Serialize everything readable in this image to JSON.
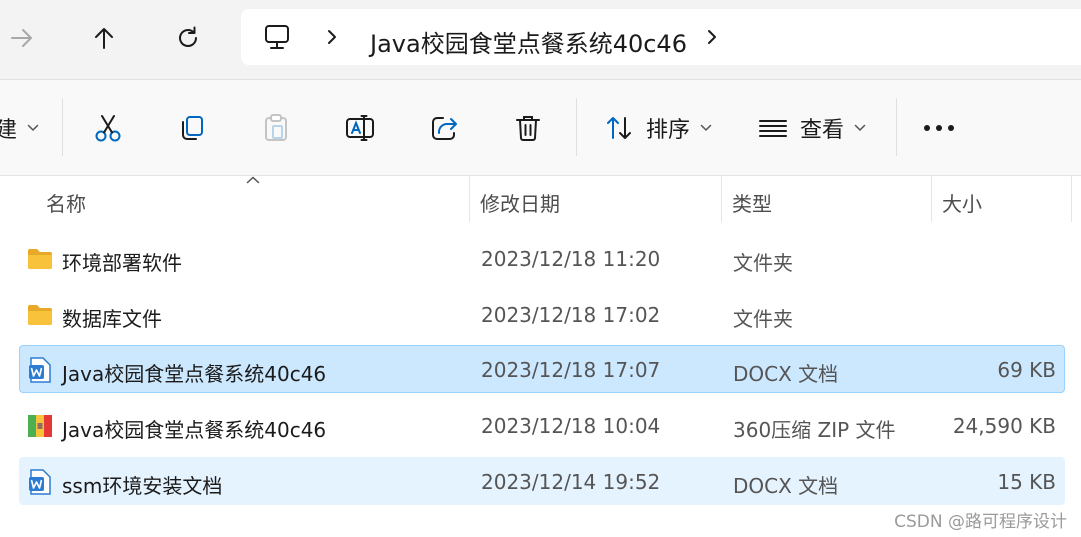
{
  "addressbar": {
    "path": "Java校园食堂点餐系统40c46"
  },
  "toolbar": {
    "new_partial": "建",
    "sort_label": "排序",
    "view_label": "查看"
  },
  "columns": {
    "name": "名称",
    "date": "修改日期",
    "type": "类型",
    "size": "大小"
  },
  "files": [
    {
      "name": "环境部署软件",
      "date": "2023/12/18 11:20",
      "type": "文件夹",
      "size": "",
      "icon": "folder-icon",
      "state": "normal"
    },
    {
      "name": "数据库文件",
      "date": "2023/12/18 17:02",
      "type": "文件夹",
      "size": "",
      "icon": "folder-icon",
      "state": "normal"
    },
    {
      "name": "Java校园食堂点餐系统40c46",
      "date": "2023/12/18 17:07",
      "type": "DOCX 文档",
      "size": "69 KB",
      "icon": "word-doc-icon",
      "state": "selected"
    },
    {
      "name": "Java校园食堂点餐系统40c46",
      "date": "2023/12/18 10:04",
      "type": "360压缩 ZIP 文件",
      "size": "24,590 KB",
      "icon": "zip-archive-icon",
      "state": "normal"
    },
    {
      "name": "ssm环境安装文档",
      "date": "2023/12/14 19:52",
      "type": "DOCX 文档",
      "size": "15 KB",
      "icon": "word-doc-icon",
      "state": "hover"
    }
  ],
  "watermark": "CSDN @路可程序设计",
  "colors": {
    "selected_bg": "#cce8ff",
    "selected_border": "#99d1ff",
    "hover_bg": "#e5f3ff",
    "accent": "#0067c0",
    "folder": "#f8c33b"
  }
}
